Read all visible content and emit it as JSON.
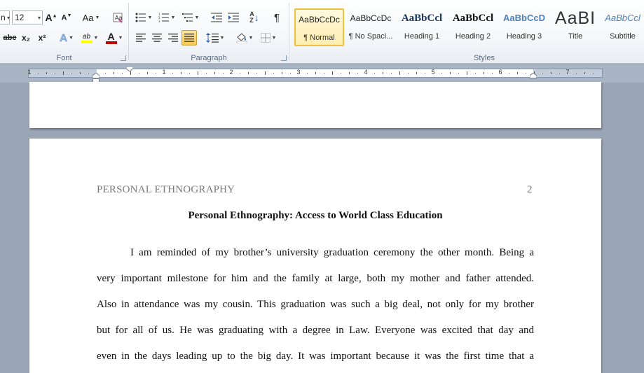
{
  "ribbon": {
    "font_group": {
      "label": "Font",
      "font_name_partial": "n",
      "font_size": "12",
      "change_case_label": "Aa",
      "strikethrough_label": "abc",
      "subscript_label": "x₂",
      "superscript_label": "x²",
      "font_color_label": "A",
      "highlight_label": "ab"
    },
    "paragraph_group": {
      "label": "Paragraph"
    },
    "styles_group": {
      "label": "Styles",
      "styles": [
        {
          "sample": "AaBbCcDc",
          "name": "¶ Normal",
          "selected": true
        },
        {
          "sample": "AaBbCcDc",
          "name": "¶ No Spaci...",
          "selected": false
        },
        {
          "sample": "AaBbCcl",
          "name": "Heading 1",
          "selected": false
        },
        {
          "sample": "AaBbCcl",
          "name": "Heading 2",
          "selected": false
        },
        {
          "sample": "AaBbCcD",
          "name": "Heading 3",
          "selected": false
        },
        {
          "sample": "AaBI",
          "name": "Title",
          "selected": false
        },
        {
          "sample": "AaBbCcl",
          "name": "Subtitle",
          "selected": false
        }
      ]
    },
    "colors": {
      "font_color": "#c00000",
      "highlight_color": "#ffff00",
      "heading3_color": "#4f81bd"
    }
  },
  "ruler": {
    "labels": [
      "1",
      "1",
      "2",
      "3",
      "4",
      "5",
      "6",
      "7"
    ]
  },
  "document": {
    "running_head": "PERSONAL ETHNOGRAPHY",
    "page_number": "2",
    "title": "Personal Ethnography: Access to World Class Education",
    "lines": [
      "I am reminded of my brother’s university graduation ceremony the other month. Being a",
      "very important milestone for him and the family at large, both my mother and father attended.",
      "Also in attendance was my cousin. This graduation was such a big deal, not only for my brother",
      "but for all of us. He was graduating with a degree in Law. Everyone was excited that day and",
      "even in the days leading up to the big day. It was important because it was the first time that a"
    ]
  }
}
